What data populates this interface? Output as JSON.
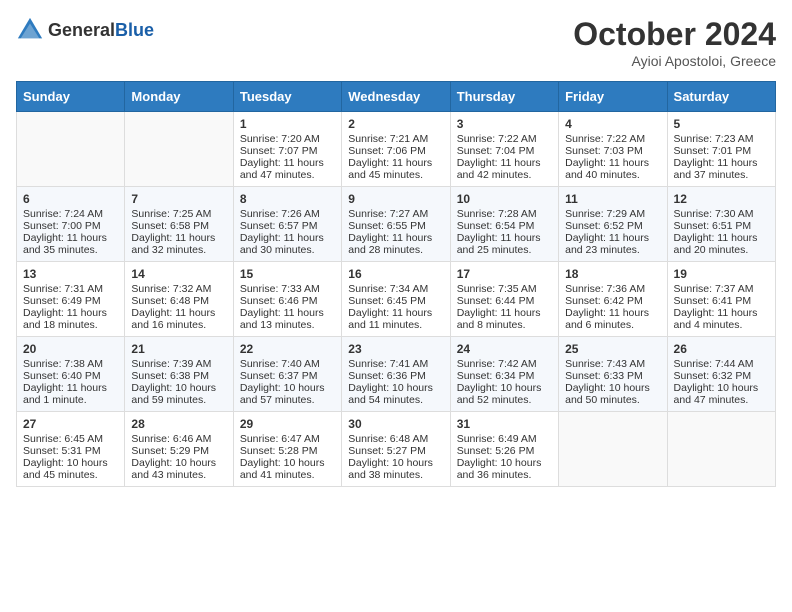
{
  "header": {
    "logo_general": "General",
    "logo_blue": "Blue",
    "month": "October 2024",
    "location": "Ayioi Apostoloi, Greece"
  },
  "weekdays": [
    "Sunday",
    "Monday",
    "Tuesday",
    "Wednesday",
    "Thursday",
    "Friday",
    "Saturday"
  ],
  "rows": [
    [
      {
        "day": "",
        "data": ""
      },
      {
        "day": "",
        "data": ""
      },
      {
        "day": "1",
        "data": "Sunrise: 7:20 AM\nSunset: 7:07 PM\nDaylight: 11 hours and 47 minutes."
      },
      {
        "day": "2",
        "data": "Sunrise: 7:21 AM\nSunset: 7:06 PM\nDaylight: 11 hours and 45 minutes."
      },
      {
        "day": "3",
        "data": "Sunrise: 7:22 AM\nSunset: 7:04 PM\nDaylight: 11 hours and 42 minutes."
      },
      {
        "day": "4",
        "data": "Sunrise: 7:22 AM\nSunset: 7:03 PM\nDaylight: 11 hours and 40 minutes."
      },
      {
        "day": "5",
        "data": "Sunrise: 7:23 AM\nSunset: 7:01 PM\nDaylight: 11 hours and 37 minutes."
      }
    ],
    [
      {
        "day": "6",
        "data": "Sunrise: 7:24 AM\nSunset: 7:00 PM\nDaylight: 11 hours and 35 minutes."
      },
      {
        "day": "7",
        "data": "Sunrise: 7:25 AM\nSunset: 6:58 PM\nDaylight: 11 hours and 32 minutes."
      },
      {
        "day": "8",
        "data": "Sunrise: 7:26 AM\nSunset: 6:57 PM\nDaylight: 11 hours and 30 minutes."
      },
      {
        "day": "9",
        "data": "Sunrise: 7:27 AM\nSunset: 6:55 PM\nDaylight: 11 hours and 28 minutes."
      },
      {
        "day": "10",
        "data": "Sunrise: 7:28 AM\nSunset: 6:54 PM\nDaylight: 11 hours and 25 minutes."
      },
      {
        "day": "11",
        "data": "Sunrise: 7:29 AM\nSunset: 6:52 PM\nDaylight: 11 hours and 23 minutes."
      },
      {
        "day": "12",
        "data": "Sunrise: 7:30 AM\nSunset: 6:51 PM\nDaylight: 11 hours and 20 minutes."
      }
    ],
    [
      {
        "day": "13",
        "data": "Sunrise: 7:31 AM\nSunset: 6:49 PM\nDaylight: 11 hours and 18 minutes."
      },
      {
        "day": "14",
        "data": "Sunrise: 7:32 AM\nSunset: 6:48 PM\nDaylight: 11 hours and 16 minutes."
      },
      {
        "day": "15",
        "data": "Sunrise: 7:33 AM\nSunset: 6:46 PM\nDaylight: 11 hours and 13 minutes."
      },
      {
        "day": "16",
        "data": "Sunrise: 7:34 AM\nSunset: 6:45 PM\nDaylight: 11 hours and 11 minutes."
      },
      {
        "day": "17",
        "data": "Sunrise: 7:35 AM\nSunset: 6:44 PM\nDaylight: 11 hours and 8 minutes."
      },
      {
        "day": "18",
        "data": "Sunrise: 7:36 AM\nSunset: 6:42 PM\nDaylight: 11 hours and 6 minutes."
      },
      {
        "day": "19",
        "data": "Sunrise: 7:37 AM\nSunset: 6:41 PM\nDaylight: 11 hours and 4 minutes."
      }
    ],
    [
      {
        "day": "20",
        "data": "Sunrise: 7:38 AM\nSunset: 6:40 PM\nDaylight: 11 hours and 1 minute."
      },
      {
        "day": "21",
        "data": "Sunrise: 7:39 AM\nSunset: 6:38 PM\nDaylight: 10 hours and 59 minutes."
      },
      {
        "day": "22",
        "data": "Sunrise: 7:40 AM\nSunset: 6:37 PM\nDaylight: 10 hours and 57 minutes."
      },
      {
        "day": "23",
        "data": "Sunrise: 7:41 AM\nSunset: 6:36 PM\nDaylight: 10 hours and 54 minutes."
      },
      {
        "day": "24",
        "data": "Sunrise: 7:42 AM\nSunset: 6:34 PM\nDaylight: 10 hours and 52 minutes."
      },
      {
        "day": "25",
        "data": "Sunrise: 7:43 AM\nSunset: 6:33 PM\nDaylight: 10 hours and 50 minutes."
      },
      {
        "day": "26",
        "data": "Sunrise: 7:44 AM\nSunset: 6:32 PM\nDaylight: 10 hours and 47 minutes."
      }
    ],
    [
      {
        "day": "27",
        "data": "Sunrise: 6:45 AM\nSunset: 5:31 PM\nDaylight: 10 hours and 45 minutes."
      },
      {
        "day": "28",
        "data": "Sunrise: 6:46 AM\nSunset: 5:29 PM\nDaylight: 10 hours and 43 minutes."
      },
      {
        "day": "29",
        "data": "Sunrise: 6:47 AM\nSunset: 5:28 PM\nDaylight: 10 hours and 41 minutes."
      },
      {
        "day": "30",
        "data": "Sunrise: 6:48 AM\nSunset: 5:27 PM\nDaylight: 10 hours and 38 minutes."
      },
      {
        "day": "31",
        "data": "Sunrise: 6:49 AM\nSunset: 5:26 PM\nDaylight: 10 hours and 36 minutes."
      },
      {
        "day": "",
        "data": ""
      },
      {
        "day": "",
        "data": ""
      }
    ]
  ]
}
